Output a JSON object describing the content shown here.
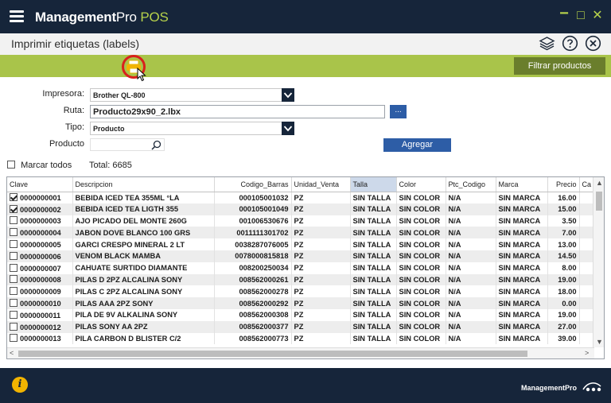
{
  "app": {
    "brand": "Management",
    "brand_light": "Pro",
    "product": "POS"
  },
  "window_controls": {
    "minimize": "−",
    "maximize": "□",
    "close": "✕"
  },
  "page": {
    "title": "Imprimir etiquetas (labels)"
  },
  "toolbar": {
    "filter_label": "Filtrar productos"
  },
  "form": {
    "printer_label": "Impresora:",
    "printer_value": "Brother QL-800",
    "route_label": "Ruta:",
    "route_value": "Producto29x90_2.lbx",
    "browse_label": "...",
    "type_label": "Tipo:",
    "type_value": "Producto",
    "product_label": "Producto",
    "product_value": "",
    "add_label": "Agregar"
  },
  "list": {
    "mark_all_label": "Marcar todos",
    "total_text": "Total: 6685"
  },
  "table": {
    "columns": [
      "Clave",
      "Descripcion",
      "Codigo_Barras",
      "Unidad_Venta",
      "Talla",
      "Color",
      "Ptc_Codigo",
      "Marca",
      "Precio",
      "Ca"
    ],
    "rows": [
      {
        "checked": true,
        "cells": [
          "0000000001",
          "BEBIDA ICED TEA 355ML °LA",
          "000105001032",
          "PZ",
          "SIN TALLA",
          "SIN COLOR",
          "N/A",
          "SIN MARCA",
          "16.00",
          ""
        ]
      },
      {
        "checked": true,
        "cells": [
          "0000000002",
          "BEBIDA ICED TEA LIGTH 355",
          "000105001049",
          "PZ",
          "SIN TALLA",
          "SIN COLOR",
          "N/A",
          "SIN MARCA",
          "15.00",
          ""
        ]
      },
      {
        "checked": false,
        "cells": [
          "0000000003",
          "AJO PICADO DEL MONTE 260G",
          "001006530676",
          "PZ",
          "SIN TALLA",
          "SIN COLOR",
          "N/A",
          "SIN MARCA",
          "3.50",
          ""
        ]
      },
      {
        "checked": false,
        "cells": [
          "0000000004",
          "JABON DOVE BLANCO 100 GRS",
          "0011111301702",
          "PZ",
          "SIN TALLA",
          "SIN COLOR",
          "N/A",
          "SIN MARCA",
          "7.00",
          ""
        ]
      },
      {
        "checked": false,
        "cells": [
          "0000000005",
          "GARCI CRESPO MINERAL 2 LT",
          "0038287076005",
          "PZ",
          "SIN TALLA",
          "SIN COLOR",
          "N/A",
          "SIN MARCA",
          "13.00",
          ""
        ]
      },
      {
        "checked": false,
        "cells": [
          "0000000006",
          "VENOM BLACK MAMBA",
          "0078000815818",
          "PZ",
          "SIN TALLA",
          "SIN COLOR",
          "N/A",
          "SIN MARCA",
          "14.50",
          ""
        ]
      },
      {
        "checked": false,
        "cells": [
          "0000000007",
          "CAHUATE SURTIDO DIAMANTE",
          "008200250034",
          "PZ",
          "SIN TALLA",
          "SIN COLOR",
          "N/A",
          "SIN MARCA",
          "8.00",
          ""
        ]
      },
      {
        "checked": false,
        "cells": [
          "0000000008",
          "PILAS D 2PZ ALCALINA SONY",
          "008562000261",
          "PZ",
          "SIN TALLA",
          "SIN COLOR",
          "N/A",
          "SIN MARCA",
          "19.00",
          ""
        ]
      },
      {
        "checked": false,
        "cells": [
          "0000000009",
          "PILAS C 2PZ ALCALINA SONY",
          "008562000278",
          "PZ",
          "SIN TALLA",
          "SIN COLOR",
          "N/A",
          "SIN MARCA",
          "18.00",
          ""
        ]
      },
      {
        "checked": false,
        "cells": [
          "0000000010",
          "PILAS AAA 2PZ SONY",
          "008562000292",
          "PZ",
          "SIN TALLA",
          "SIN COLOR",
          "N/A",
          "SIN MARCA",
          "0.00",
          ""
        ]
      },
      {
        "checked": false,
        "cells": [
          "0000000011",
          "PILA DE 9V ALKALINA SONY",
          "008562000308",
          "PZ",
          "SIN TALLA",
          "SIN COLOR",
          "N/A",
          "SIN MARCA",
          "19.00",
          ""
        ]
      },
      {
        "checked": false,
        "cells": [
          "0000000012",
          "PILAS SONY AA 2PZ",
          "008562000377",
          "PZ",
          "SIN TALLA",
          "SIN COLOR",
          "N/A",
          "SIN MARCA",
          "27.00",
          ""
        ]
      },
      {
        "checked": false,
        "cells": [
          "0000000013",
          "PILA CARBON D BLISTER C/2",
          "008562000773",
          "PZ",
          "SIN TALLA",
          "SIN COLOR",
          "N/A",
          "SIN MARCA",
          "39.00",
          ""
        ]
      }
    ]
  },
  "footer": {
    "logo_text": "ManagementPro"
  },
  "colors": {
    "navy": "#16253a",
    "lime": "#a9c44a",
    "lime_dark": "#6a7e2c",
    "blue_button": "#2d5da6",
    "info_yellow": "#f2b400",
    "highlight_red": "#d9201c"
  },
  "icons": [
    "menu-icon",
    "layers-icon",
    "help-icon",
    "close-circle-icon",
    "printer-icon",
    "search-icon",
    "info-icon",
    "dropdown-arrow-icon"
  ]
}
